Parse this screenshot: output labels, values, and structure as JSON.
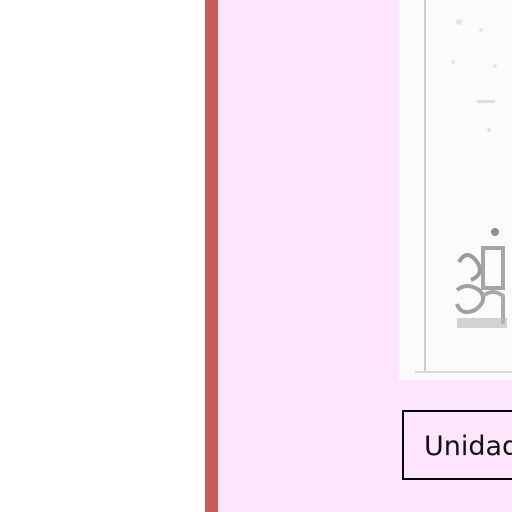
{
  "sidebar": {
    "accent_color": "#c65b5b"
  },
  "content": {
    "background_color": "#fde6fd",
    "thumbnail": {
      "kind": "faded-document-scan"
    },
    "unit_button": {
      "label": "Unidad"
    }
  }
}
